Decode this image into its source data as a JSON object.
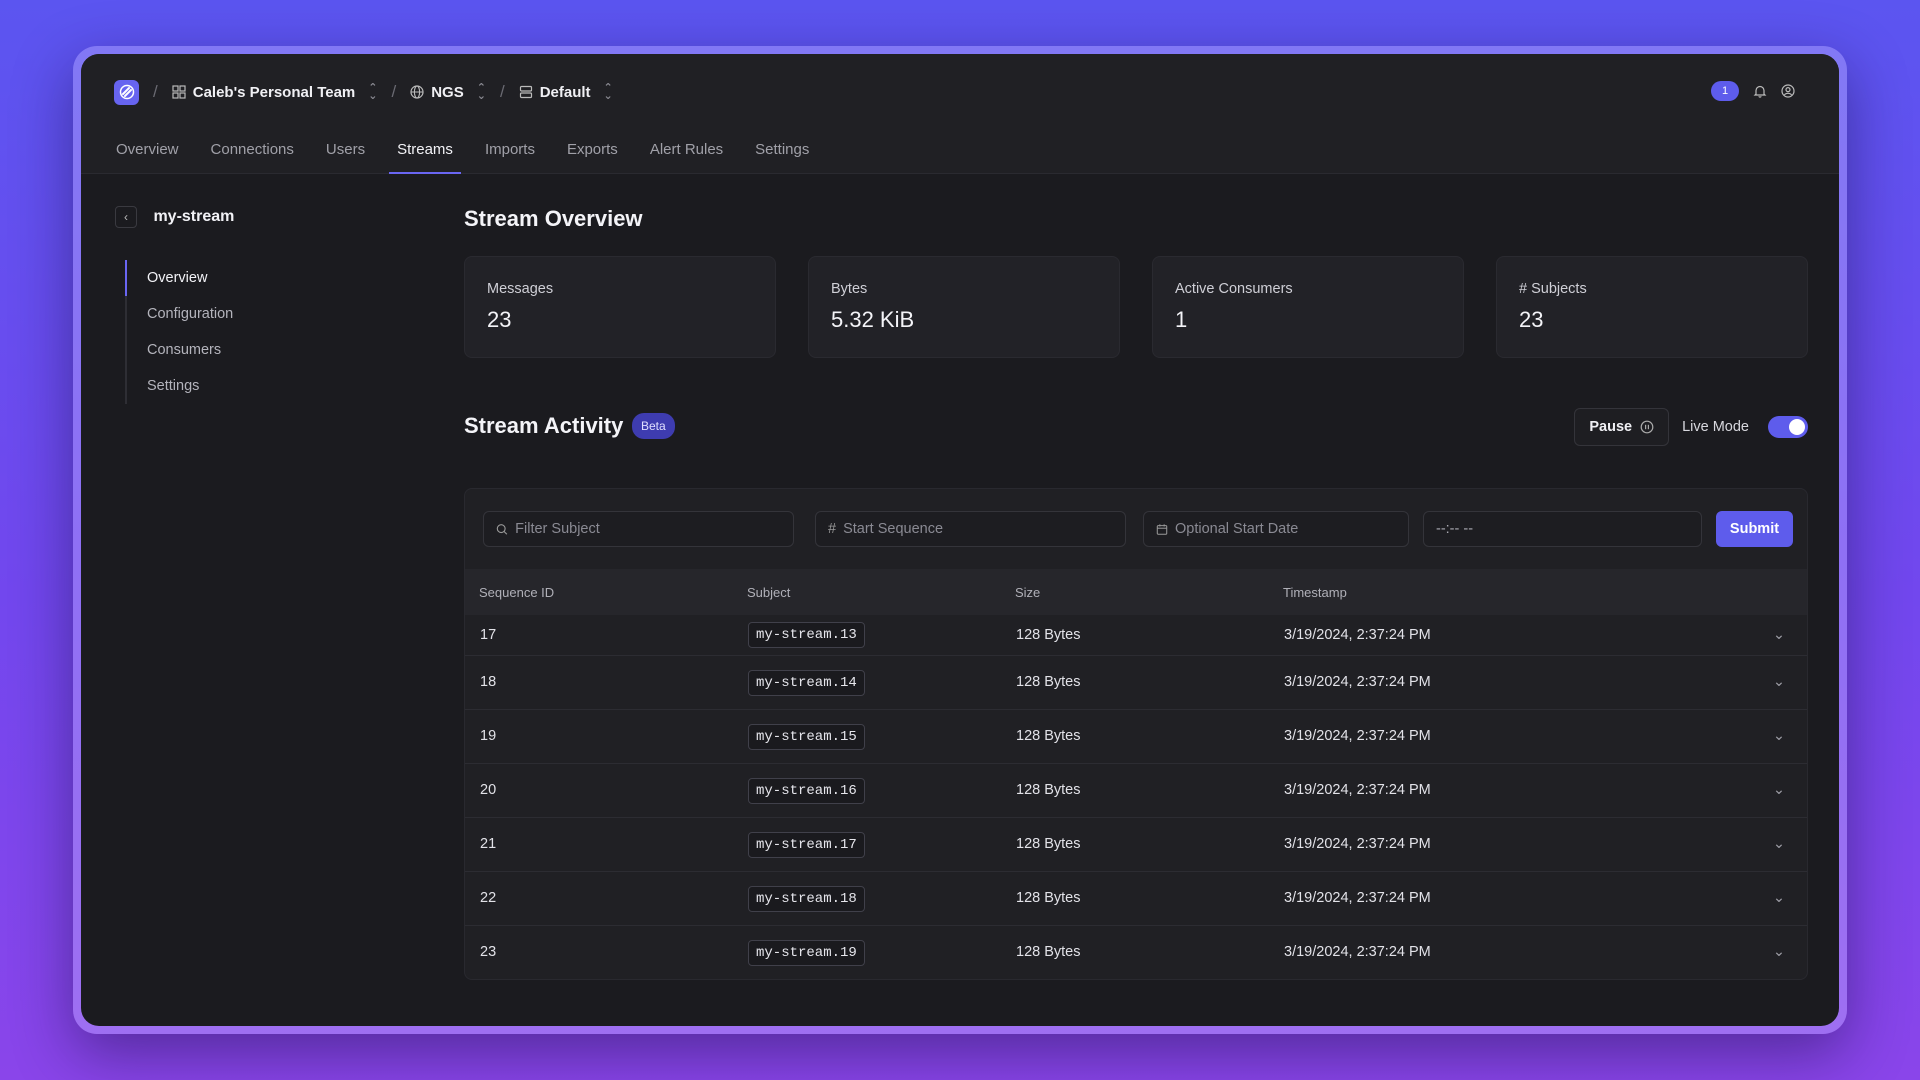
{
  "breadcrumb": {
    "team": "Caleb's Personal Team",
    "system": "NGS",
    "account": "Default"
  },
  "header": {
    "notification_count": "1"
  },
  "tabs": [
    {
      "label": "Overview"
    },
    {
      "label": "Connections"
    },
    {
      "label": "Users"
    },
    {
      "label": "Streams",
      "active": true
    },
    {
      "label": "Imports"
    },
    {
      "label": "Exports"
    },
    {
      "label": "Alert Rules"
    },
    {
      "label": "Settings"
    }
  ],
  "sidebar": {
    "title": "my-stream",
    "items": [
      {
        "label": "Overview",
        "active": true
      },
      {
        "label": "Configuration"
      },
      {
        "label": "Consumers"
      },
      {
        "label": "Settings"
      }
    ]
  },
  "overview": {
    "title": "Stream Overview",
    "cards": [
      {
        "label": "Messages",
        "value": "23"
      },
      {
        "label": "Bytes",
        "value": "5.32 KiB"
      },
      {
        "label": "Active Consumers",
        "value": "1"
      },
      {
        "label": "# Subjects",
        "value": "23"
      }
    ]
  },
  "activity": {
    "title": "Stream Activity",
    "badge": "Beta",
    "pause_label": "Pause",
    "live_mode_label": "Live Mode",
    "live_mode_on": true
  },
  "filters": {
    "subject_placeholder": "Filter Subject",
    "sequence_placeholder": "Start Sequence",
    "date_placeholder": "Optional Start Date",
    "time_value": "--:-- --",
    "submit_label": "Submit"
  },
  "table": {
    "columns": [
      "Sequence ID",
      "Subject",
      "Size",
      "Timestamp"
    ],
    "rows": [
      {
        "seq": "17",
        "subject": "my-stream.13",
        "size": "128 Bytes",
        "timestamp": "3/19/2024, 2:37:24 PM"
      },
      {
        "seq": "18",
        "subject": "my-stream.14",
        "size": "128 Bytes",
        "timestamp": "3/19/2024, 2:37:24 PM"
      },
      {
        "seq": "19",
        "subject": "my-stream.15",
        "size": "128 Bytes",
        "timestamp": "3/19/2024, 2:37:24 PM"
      },
      {
        "seq": "20",
        "subject": "my-stream.16",
        "size": "128 Bytes",
        "timestamp": "3/19/2024, 2:37:24 PM"
      },
      {
        "seq": "21",
        "subject": "my-stream.17",
        "size": "128 Bytes",
        "timestamp": "3/19/2024, 2:37:24 PM"
      },
      {
        "seq": "22",
        "subject": "my-stream.18",
        "size": "128 Bytes",
        "timestamp": "3/19/2024, 2:37:24 PM"
      },
      {
        "seq": "23",
        "subject": "my-stream.19",
        "size": "128 Bytes",
        "timestamp": "3/19/2024, 2:37:24 PM"
      }
    ]
  },
  "colors": {
    "accent": "#5e5cec",
    "background": "#1b1b1f"
  }
}
